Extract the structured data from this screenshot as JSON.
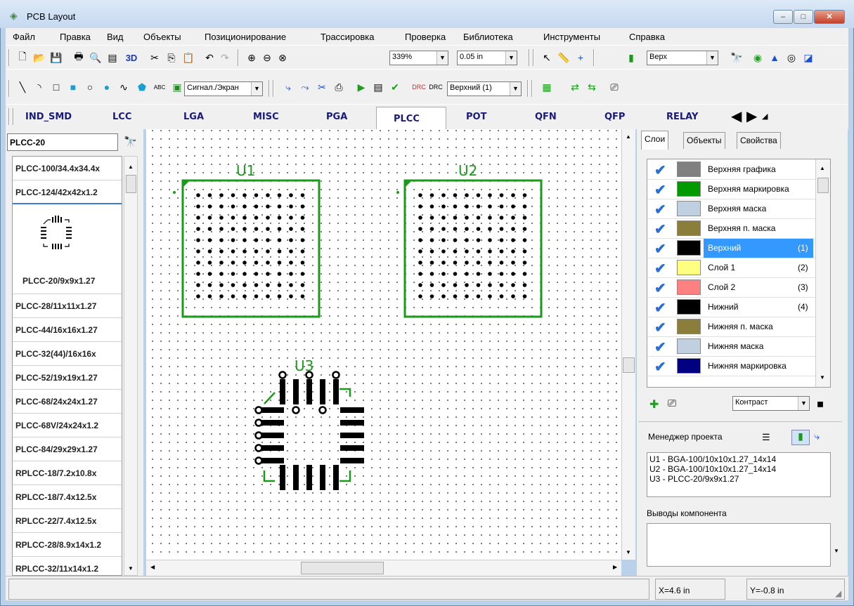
{
  "window": {
    "title": "PCB Layout",
    "minimize": "‒",
    "maximize": "□",
    "close": "✕"
  },
  "menu": [
    "Файл",
    "Правка",
    "Вид",
    "Объекты",
    "Позиционирование",
    "Трассировка",
    "Проверка",
    "Библиотека",
    "Инструменты",
    "Справка"
  ],
  "toolbar1": {
    "btn_3d": "3D",
    "zoom": "339%",
    "grid": "0.05 in",
    "side": "Верх"
  },
  "toolbar2": {
    "mode": "Сигнал./Экран",
    "layer": "Верхний (1)",
    "abc": "ABC"
  },
  "lib_tabs": [
    "IND_SMD",
    "LCC",
    "LGA",
    "MISC",
    "PGA",
    "PLCC",
    "POT",
    "QFN",
    "QFP",
    "RELAY"
  ],
  "lib_active_tab": "PLCC",
  "library": {
    "search_value": "PLCC-20",
    "items": [
      "PLCC-100/34.4x34.4x",
      "PLCC-124/42x42x1.2",
      "PLCC-20/9x9x1.27",
      "PLCC-28/11x11x1.27",
      "PLCC-44/16x16x1.27",
      "PLCC-32(44)/16x16x",
      "PLCC-52/19x19x1.27",
      "PLCC-68/24x24x1.27",
      "PLCC-68V/24x24x1.2",
      "PLCC-84/29x29x1.27",
      "RPLCC-18/7.2x10.8x",
      "RPLCC-18/7.4x12.5x",
      "RPLCC-22/7.4x12.5x",
      "RPLCC-28/8.9x14x1.2",
      "RPLCC-32/11x14x1.2"
    ],
    "selected": "PLCC-20/9x9x1.27"
  },
  "components": {
    "u1": "U1",
    "u2": "U2",
    "u3": "U3"
  },
  "right_tabs": [
    "Слои",
    "Объекты",
    "Свойства"
  ],
  "layers": [
    {
      "name": "Верхняя графика",
      "color": "#808080",
      "num": ""
    },
    {
      "name": "Верхняя маркировка",
      "color": "#009900",
      "num": ""
    },
    {
      "name": "Верхняя маска",
      "color": "#c0d0e0",
      "num": ""
    },
    {
      "name": "Верхняя п. маска",
      "color": "#8b7d3a",
      "num": ""
    },
    {
      "name": "Верхний",
      "color": "#000000",
      "num": "(1)",
      "selected": true
    },
    {
      "name": "Слой 1",
      "color": "#ffff80",
      "num": "(2)"
    },
    {
      "name": "Слой 2",
      "color": "#ff8080",
      "num": "(3)"
    },
    {
      "name": "Нижний",
      "color": "#000000",
      "num": "(4)"
    },
    {
      "name": "Нижняя п. маска",
      "color": "#8b7d3a",
      "num": ""
    },
    {
      "name": "Нижняя маска",
      "color": "#c0d0e0",
      "num": ""
    },
    {
      "name": "Нижняя маркировка",
      "color": "#000080",
      "num": ""
    }
  ],
  "contrast": "Контраст",
  "project_manager": {
    "title": "Менеджер проекта",
    "items": [
      "U1 - BGA-100/10x10x1.27_14x14",
      "U2 - BGA-100/10x10x1.27_14x14",
      "U3 - PLCC-20/9x9x1.27"
    ]
  },
  "pins_title": "Выводы компонента",
  "status": {
    "x": "X=4.6 in",
    "y": "Y=-0.8 in"
  }
}
